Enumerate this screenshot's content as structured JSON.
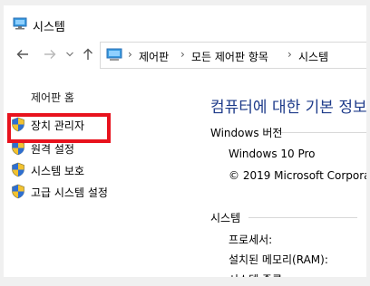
{
  "window": {
    "title": "시스템"
  },
  "nav": {
    "back_icon": "arrow-left-icon",
    "forward_icon": "arrow-right-icon",
    "dropdown_icon": "chevron-down-icon",
    "up_icon": "arrow-up-icon"
  },
  "address": {
    "crumbs": [
      "제어판",
      "모든 제어판 항목",
      "시스템"
    ]
  },
  "sidebar": {
    "home": "제어판 홈",
    "items": [
      {
        "label": "장치 관리자",
        "icon": "uac-shield-icon"
      },
      {
        "label": "원격 설정",
        "icon": "uac-shield-icon"
      },
      {
        "label": "시스템 보호",
        "icon": "uac-shield-icon"
      },
      {
        "label": "고급 시스템 설정",
        "icon": "uac-shield-icon"
      }
    ]
  },
  "main": {
    "heading": "컴퓨터에 대한 기본 정보",
    "windows_edition": {
      "label": "Windows 버전",
      "name": "Windows 10 Pro",
      "copyright": "© 2019 Microsoft Corporation"
    },
    "system": {
      "label": "시스템",
      "processor": "프로세서:",
      "ram": "설치된 메모리(RAM):",
      "type": "시스템 종류:"
    }
  },
  "colors": {
    "highlight": "#e8121d",
    "heading": "#1e3b8a"
  }
}
